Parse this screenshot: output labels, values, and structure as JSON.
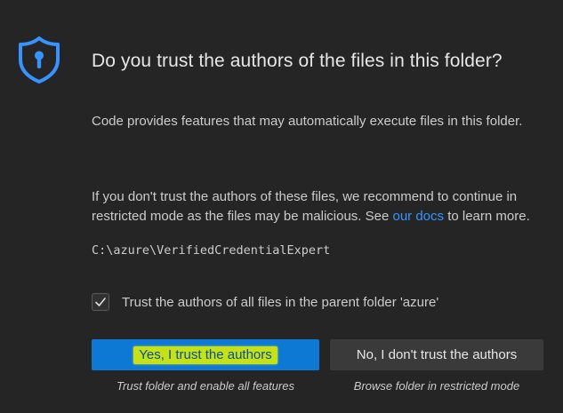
{
  "dialog": {
    "title": "Do you trust the authors of the files in this folder?",
    "icon": "shield-keyhole-icon",
    "accent_color": "#3794ff",
    "paragraph1": "Code provides features that may automatically execute files in this folder.",
    "paragraph2_before_link": "If you don't trust the authors of these files, we recommend to continue in restricted mode as the files may be malicious. See ",
    "paragraph2_link": "our docs",
    "paragraph2_after_link": " to learn more.",
    "folder_path": "C:\\azure\\VerifiedCredentialExpert",
    "checkbox": {
      "checked": true,
      "label": "Trust the authors of all files in the parent folder 'azure'"
    },
    "buttons": {
      "trust": {
        "label": "Yes, I trust the authors",
        "caption": "Trust folder and enable all features",
        "color": "#0e79d4",
        "highlight_color": "#c5e11a"
      },
      "dont_trust": {
        "label": "No, I don't trust the authors",
        "caption": "Browse folder in restricted mode",
        "color": "#3a3a3a"
      }
    }
  }
}
